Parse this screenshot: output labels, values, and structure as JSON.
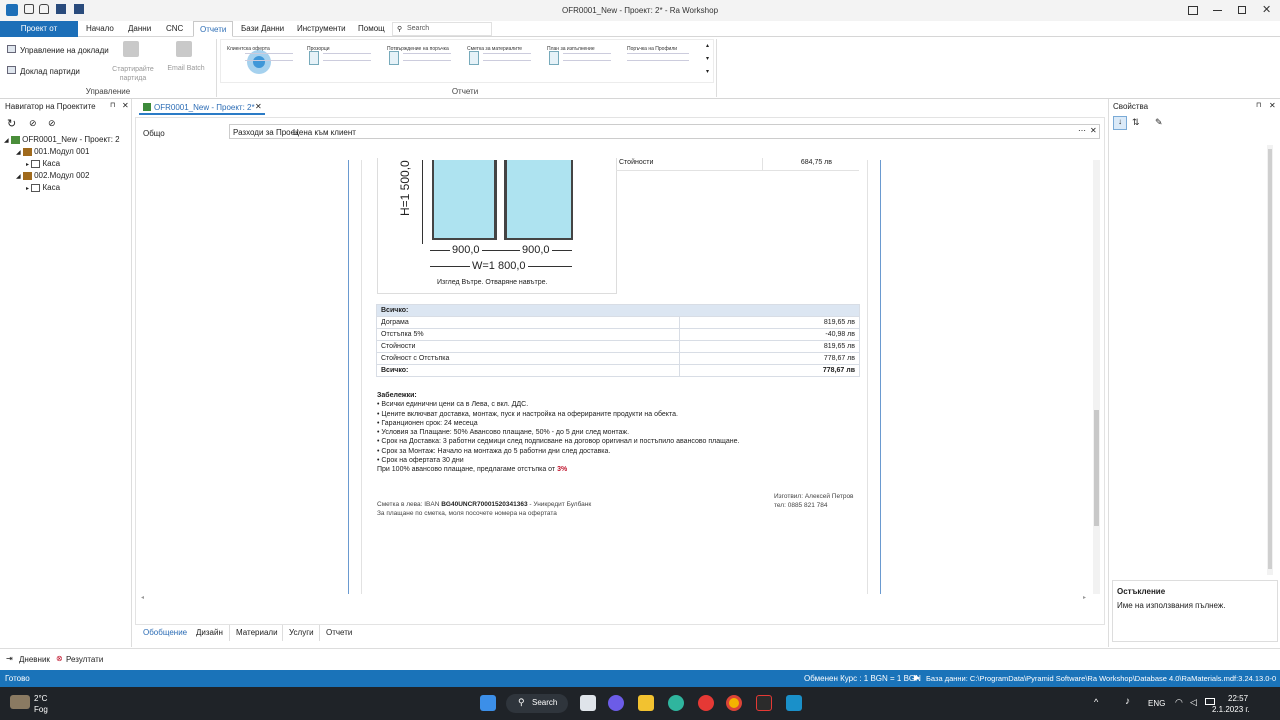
{
  "window": {
    "title": "OFR0001_New - Проект: 2* - Ra Workshop"
  },
  "ribbon_tabs": [
    "Проект от файл",
    "Начало",
    "Данни",
    "CNC",
    "Отчети",
    "Бази Данни",
    "Инструменти",
    "Помощ"
  ],
  "search_placeholder": "Search",
  "ribbon": {
    "manage_reports": "Управление на доклади",
    "batch_report": "Доклад партиди",
    "start_batch": "Стартирайте партида",
    "email_batch": "Email Batch",
    "group_manage": "Управление",
    "group_reports": "Отчети",
    "gallery": [
      "Клиентска оферта",
      "Прозорци",
      "Потвърждение на поръчка",
      "Сметка за материалите",
      "План за изпълнение",
      "Поръчка на Профили"
    ]
  },
  "navigator": {
    "title": "Навигатор на Проектите",
    "tree": [
      "OFR0001_New - Проект: 2",
      "001.Модул 001",
      "Каса",
      "002.Модул 002",
      "Каса"
    ]
  },
  "doc_tab": "OFR0001_New - Проект: 2*",
  "left_label": "Общо",
  "report_selector": {
    "option1": "Разходи за Проек",
    "option2": "Цена към клиент"
  },
  "document": {
    "summary_row": {
      "label": "Стойности",
      "value": "684,75 лв"
    },
    "dims": {
      "height": "H=1 500,0",
      "w1": "900,0",
      "w2": "900,0",
      "total": "W=1 800,0"
    },
    "caption": "Изглед Вътре. Отваряне навътре.",
    "totals_header": "Всичко:",
    "totals": [
      {
        "label": "Дограма",
        "value": "819,65 лв"
      },
      {
        "label": "Отстъпка 5%",
        "value": "-40,98 лв"
      },
      {
        "label": "Стойности",
        "value": "819,65 лв"
      },
      {
        "label": "Стойност с Отстъпка",
        "value": "778,67 лв"
      },
      {
        "label": "Всичко:",
        "value": "778,67 лв"
      }
    ],
    "notes_title": "Забележки:",
    "notes": [
      "• Всички единични цени са в Лева, с вкл. ДДС.",
      "• Цените включват доставка, монтаж, пуск и настройка на оферираните продукти на обекта.",
      "• Гаранционен срок: 24 месеца",
      "• Условия за Плащане: 50% Авансово плащане, 50% - до 5 дни след монтаж.",
      "• Срок на Доставка: 3 работни седмици след подписване на договор оригинал и постъпило авансово плащане.",
      "• Срок за Монтаж: Начало на монтажа до 5 работни дни след доставка.",
      "• Срок на офертата 30 дни"
    ],
    "discount_note": "При 100% авансово плащане, предлагаме отстъпка от",
    "discount_value": "3%",
    "bank_prefix": "Сметка в лева: IBAN",
    "iban": "BG40UNCR70001520341363",
    "bank_suffix": " - Уникредит Булбанк",
    "pay_note": "За плащане по сметка, моля посочете номера на офертата",
    "prepared_by": "Изготвил: Алексей Петров",
    "phone": "тел: 0885 821 784"
  },
  "bottom_tabs": [
    "Обобщение",
    "Дизайн",
    "Материали",
    "Услуги",
    "Отчети"
  ],
  "properties": {
    "title": "Свойства",
    "section": "Остъкление",
    "desc": "Име на използвания пълнеж."
  },
  "bottom_bar": {
    "journal": "Дневник",
    "results": "Резултати"
  },
  "status": {
    "ready": "Готово",
    "rate": "Обменен Курс : 1 BGN = 1 BGN",
    "db": "База данни: C:\\ProgramData\\Pyramid Software\\Ra Workshop\\Database 4.0\\RaMaterials.mdf:3.24.13.0-0"
  },
  "taskbar": {
    "temp": "2°C",
    "weather": "Fog",
    "search": "Search",
    "lang": "ENG",
    "time": "22:57",
    "date": "2.1.2023 г."
  }
}
